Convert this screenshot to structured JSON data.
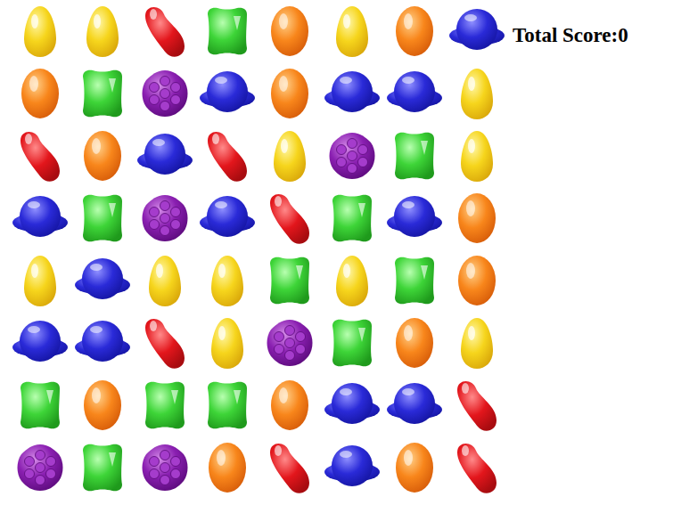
{
  "score": {
    "text": "Total Score:0"
  },
  "board": {
    "rows": [
      [
        {
          "kind": "yellow"
        },
        {
          "kind": "yellow"
        },
        {
          "kind": "red"
        },
        {
          "kind": "green"
        },
        {
          "kind": "orange"
        },
        {
          "kind": "yellow"
        },
        {
          "kind": "orange"
        },
        {
          "kind": "blue"
        }
      ],
      [
        {
          "kind": "orange"
        },
        {
          "kind": "green"
        },
        {
          "kind": "purple"
        },
        {
          "kind": "blue"
        },
        {
          "kind": "orange"
        },
        {
          "kind": "blue"
        },
        {
          "kind": "blue"
        },
        {
          "kind": "yellow"
        }
      ],
      [
        {
          "kind": "red"
        },
        {
          "kind": "orange"
        },
        {
          "kind": "blue"
        },
        {
          "kind": "red"
        },
        {
          "kind": "yellow"
        },
        {
          "kind": "purple"
        },
        {
          "kind": "green"
        },
        {
          "kind": "yellow"
        }
      ],
      [
        {
          "kind": "blue"
        },
        {
          "kind": "green"
        },
        {
          "kind": "purple"
        },
        {
          "kind": "blue"
        },
        {
          "kind": "red"
        },
        {
          "kind": "green"
        },
        {
          "kind": "blue"
        },
        {
          "kind": "orange"
        }
      ],
      [
        {
          "kind": "yellow"
        },
        {
          "kind": "blue"
        },
        {
          "kind": "yellow"
        },
        {
          "kind": "yellow"
        },
        {
          "kind": "green"
        },
        {
          "kind": "yellow"
        },
        {
          "kind": "green"
        },
        {
          "kind": "orange"
        }
      ],
      [
        {
          "kind": "blue"
        },
        {
          "kind": "blue"
        },
        {
          "kind": "red"
        },
        {
          "kind": "yellow"
        },
        {
          "kind": "purple"
        },
        {
          "kind": "green"
        },
        {
          "kind": "orange"
        },
        {
          "kind": "yellow"
        }
      ],
      [
        {
          "kind": "green"
        },
        {
          "kind": "orange"
        },
        {
          "kind": "green"
        },
        {
          "kind": "green"
        },
        {
          "kind": "orange"
        },
        {
          "kind": "blue"
        },
        {
          "kind": "blue"
        },
        {
          "kind": "red"
        }
      ],
      [
        {
          "kind": "purple"
        },
        {
          "kind": "green"
        },
        {
          "kind": "purple"
        },
        {
          "kind": "orange"
        },
        {
          "kind": "red"
        },
        {
          "kind": "blue"
        },
        {
          "kind": "orange"
        },
        {
          "kind": "red"
        }
      ]
    ]
  }
}
